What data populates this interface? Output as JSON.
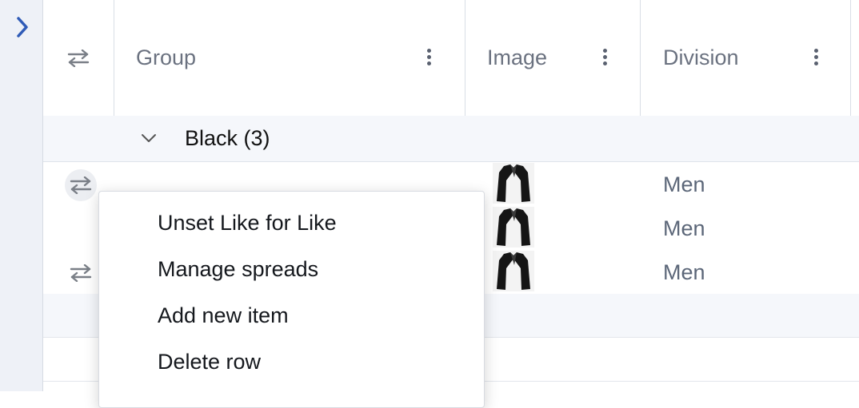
{
  "columns": [
    {
      "label": ""
    },
    {
      "label": "Group"
    },
    {
      "label": "Image"
    },
    {
      "label": "Division"
    }
  ],
  "group": {
    "label": "Black (3)"
  },
  "rows": [
    {
      "division": "Men",
      "has_swap": true,
      "swap_active": true
    },
    {
      "division": "Men",
      "has_swap": false,
      "swap_active": false
    },
    {
      "division": "Men",
      "has_swap": true,
      "swap_active": false
    }
  ],
  "context_menu": {
    "items": [
      {
        "label": "Unset Like for Like"
      },
      {
        "label": "Manage spreads"
      },
      {
        "label": "Add new item"
      },
      {
        "label": "Delete row"
      }
    ]
  },
  "icons": {
    "expand": "chevron-right-icon",
    "swap": "swap-arrows-icon",
    "group_toggle": "chevron-down-icon",
    "column_menu": "kebab-menu-icon",
    "product": "black-jacket-thumbnail"
  },
  "colors": {
    "accent": "#2f5bb7",
    "group_row_bg": "#f5f7fb",
    "rail_bg": "#eef1f7",
    "division_text": "#5b6678"
  }
}
